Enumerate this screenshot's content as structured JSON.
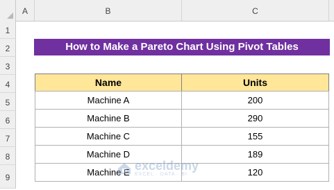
{
  "columns": [
    "A",
    "B",
    "C"
  ],
  "rows": [
    "1",
    "2",
    "3",
    "4",
    "5",
    "6",
    "7",
    "8",
    "9"
  ],
  "title": "How to Make a Pareto Chart Using Pivot Tables",
  "table": {
    "headers": [
      "Name",
      "Units"
    ],
    "rows": [
      [
        "Machine A",
        "200"
      ],
      [
        "Machine B",
        "290"
      ],
      [
        "Machine C",
        "155"
      ],
      [
        "Machine D",
        "189"
      ],
      [
        "Machine E",
        "120"
      ]
    ]
  },
  "watermark": {
    "name": "exceldemy",
    "tagline": "EXCEL · DATA · BI"
  }
}
